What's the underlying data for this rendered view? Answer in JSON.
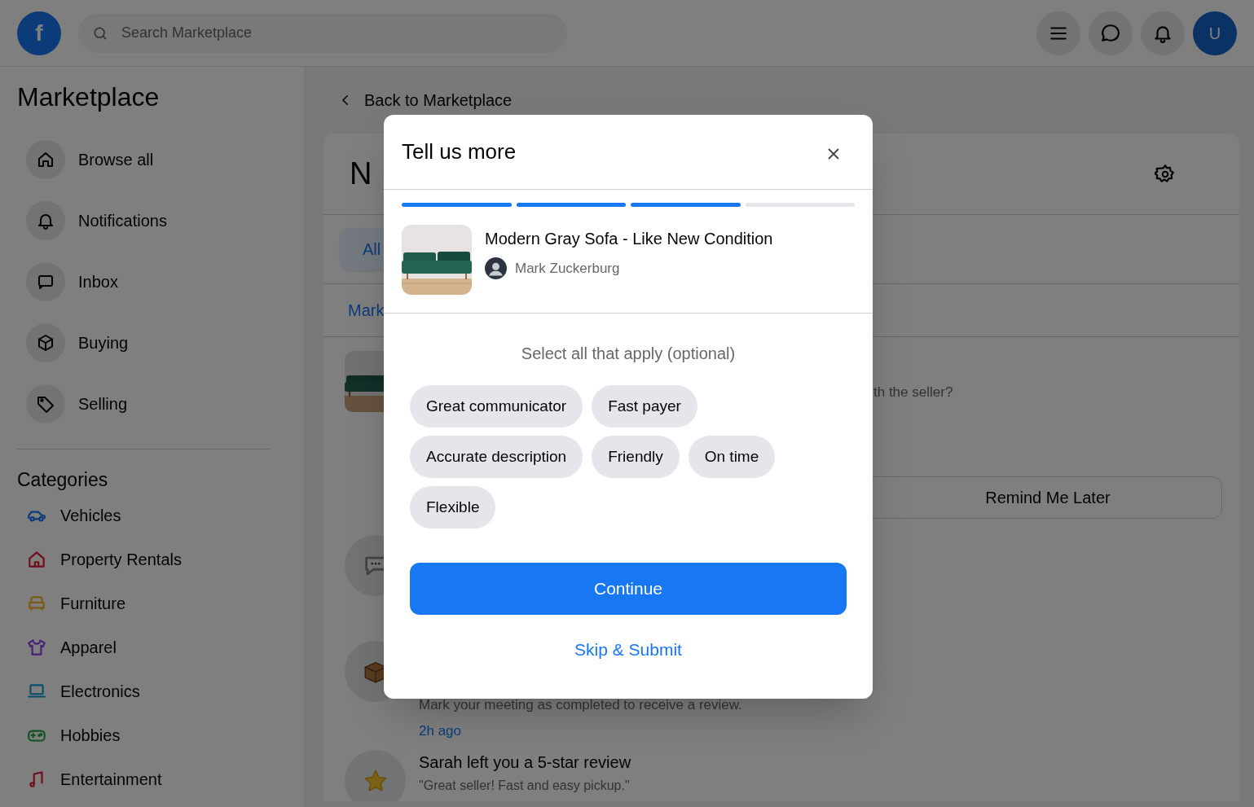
{
  "top_bar": {
    "logo": "f",
    "search": {
      "placeholder": "Search Marketplace"
    },
    "avatar": "U"
  },
  "sidebar": {
    "title": "Marketplace",
    "items": [
      {
        "label": "Browse all"
      },
      {
        "label": "Notifications"
      },
      {
        "label": "Inbox"
      },
      {
        "label": "Buying"
      },
      {
        "label": "Selling"
      }
    ],
    "categories_title": "Categories",
    "categories": [
      {
        "label": "Vehicles",
        "color": "#0c3b79"
      },
      {
        "label": "Property Rentals",
        "color": "#720f1f"
      },
      {
        "label": "Furniture",
        "color": "#7c5c14"
      },
      {
        "label": "Apparel",
        "color": "#472274"
      },
      {
        "label": "Electronics",
        "color": "#055068"
      },
      {
        "label": "Hobbies",
        "color": "#0f5223"
      },
      {
        "label": "Entertainment",
        "color": "#720f1f"
      }
    ]
  },
  "main": {
    "back_link": "Back to Marketplace",
    "heading": "N",
    "filter": "All",
    "tab": "Mark",
    "notifications": [
      {
        "kind": "prompt",
        "text": "th the seller?",
        "button": "Remind Me Later"
      },
      {
        "kind": "message"
      },
      {
        "kind": "meetup",
        "text": "Mark your meeting as completed to receive a review.",
        "time": "2h ago"
      },
      {
        "kind": "review",
        "title": "Sarah left you a 5-star review",
        "text": "\"Great seller! Fast and easy pickup.\""
      }
    ]
  },
  "dialog": {
    "title": "Tell us more",
    "steps": [
      {
        "done": true
      },
      {
        "done": true
      },
      {
        "done": true
      },
      {
        "done": false
      }
    ],
    "item": {
      "title": "Modern Gray Sofa - Like New Condition",
      "seller": "Mark Zuckerburg"
    },
    "prompt": "Select all that apply (optional)",
    "chips": [
      {
        "label": "Great communicator",
        "selected": false
      },
      {
        "label": "Fast payer",
        "selected": false
      },
      {
        "label": "Accurate description",
        "selected": false
      },
      {
        "label": "Friendly",
        "selected": false
      },
      {
        "label": "On time",
        "selected": false
      },
      {
        "label": "Flexible",
        "selected": false
      }
    ],
    "primary_button": "Continue",
    "secondary_link": "Skip & Submit"
  }
}
